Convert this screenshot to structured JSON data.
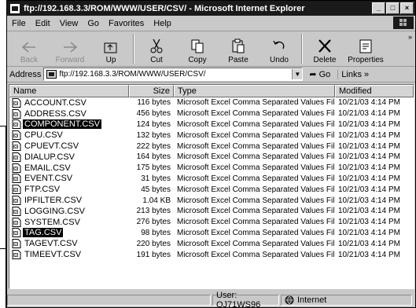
{
  "window": {
    "title": "ftp://192.168.3.3/ROM/WWW/USER/CSV/ - Microsoft Internet Explorer"
  },
  "menu": [
    "File",
    "Edit",
    "View",
    "Go",
    "Favorites",
    "Help"
  ],
  "toolbar": [
    {
      "label": "Back",
      "icon": "back-arrow-icon",
      "enabled": false
    },
    {
      "label": "Forward",
      "icon": "forward-arrow-icon",
      "enabled": false
    },
    {
      "label": "Up",
      "icon": "up-folder-icon",
      "enabled": true
    },
    {
      "label": "Cut",
      "icon": "scissors-icon",
      "enabled": true
    },
    {
      "label": "Copy",
      "icon": "copy-icon",
      "enabled": true
    },
    {
      "label": "Paste",
      "icon": "paste-icon",
      "enabled": true
    },
    {
      "label": "Undo",
      "icon": "undo-icon",
      "enabled": true
    },
    {
      "label": "Delete",
      "icon": "delete-x-icon",
      "enabled": true
    },
    {
      "label": "Properties",
      "icon": "properties-icon",
      "enabled": true
    }
  ],
  "address": {
    "label": "Address",
    "value": "ftp://192.168.3.3/ROM/WWW/USER/CSV/",
    "go": "Go",
    "links": "Links"
  },
  "columns": [
    "Name",
    "Size",
    "Type",
    "Modified"
  ],
  "files": [
    {
      "name": "ACCOUNT.CSV",
      "size": "116 bytes",
      "type": "Microsoft Excel Comma Separated Values File",
      "modified": "10/21/03 4:14 PM",
      "selected": false
    },
    {
      "name": "ADDRESS.CSV",
      "size": "456 bytes",
      "type": "Microsoft Excel Comma Separated Values File",
      "modified": "10/21/03 4:14 PM",
      "selected": false
    },
    {
      "name": "COMPONENT.CSV",
      "size": "124 bytes",
      "type": "Microsoft Excel Comma Separated Values File",
      "modified": "10/21/03 4:14 PM",
      "selected": true
    },
    {
      "name": "CPU.CSV",
      "size": "132 bytes",
      "type": "Microsoft Excel Comma Separated Values File",
      "modified": "10/21/03 4:14 PM",
      "selected": false
    },
    {
      "name": "CPUEVT.CSV",
      "size": "222 bytes",
      "type": "Microsoft Excel Comma Separated Values File",
      "modified": "10/21/03 4:14 PM",
      "selected": false
    },
    {
      "name": "DIALUP.CSV",
      "size": "164 bytes",
      "type": "Microsoft Excel Comma Separated Values File",
      "modified": "10/21/03 4:14 PM",
      "selected": false
    },
    {
      "name": "EMAIL.CSV",
      "size": "175 bytes",
      "type": "Microsoft Excel Comma Separated Values File",
      "modified": "10/21/03 4:14 PM",
      "selected": false
    },
    {
      "name": "EVENT.CSV",
      "size": "31 bytes",
      "type": "Microsoft Excel Comma Separated Values File",
      "modified": "10/21/03 4:14 PM",
      "selected": false
    },
    {
      "name": "FTP.CSV",
      "size": "45 bytes",
      "type": "Microsoft Excel Comma Separated Values File",
      "modified": "10/21/03 4:14 PM",
      "selected": false
    },
    {
      "name": "IPFILTER.CSV",
      "size": "1.04 KB",
      "type": "Microsoft Excel Comma Separated Values File",
      "modified": "10/21/03 4:14 PM",
      "selected": false
    },
    {
      "name": "LOGGING.CSV",
      "size": "213 bytes",
      "type": "Microsoft Excel Comma Separated Values File",
      "modified": "10/21/03 4:14 PM",
      "selected": false
    },
    {
      "name": "SYSTEM.CSV",
      "size": "276 bytes",
      "type": "Microsoft Excel Comma Separated Values File",
      "modified": "10/21/03 4:14 PM",
      "selected": false
    },
    {
      "name": "TAG.CSV",
      "size": "98 bytes",
      "type": "Microsoft Excel Comma Separated Values File",
      "modified": "10/21/03 4:14 PM",
      "selected": true
    },
    {
      "name": "TAGEVT.CSV",
      "size": "220 bytes",
      "type": "Microsoft Excel Comma Separated Values File",
      "modified": "10/21/03 4:14 PM",
      "selected": false
    },
    {
      "name": "TIMEEVT.CSV",
      "size": "191 bytes",
      "type": "Microsoft Excel Comma Separated Values File",
      "modified": "10/21/03 4:14 PM",
      "selected": false
    }
  ],
  "status": {
    "user": "User: QJ71WS96",
    "zone": "Internet"
  }
}
